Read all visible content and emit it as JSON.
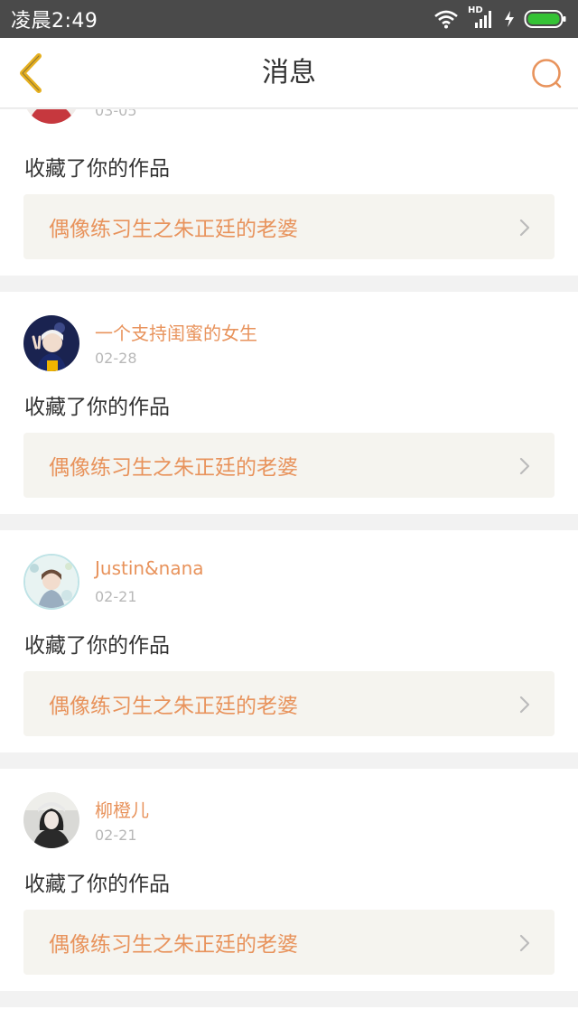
{
  "status_bar": {
    "time": "凌晨2:49",
    "network_label": "HD"
  },
  "header": {
    "title": "消息",
    "back_icon": "chevron-left-icon",
    "search_icon": "search-icon"
  },
  "colors": {
    "accent": "#e8935c",
    "back_icon": "#e6b020",
    "battery": "#35c235"
  },
  "messages": [
    {
      "user": "",
      "date": "03-05",
      "action": "收藏了你的作品",
      "work_title": "偶像练习生之朱正廷的老婆"
    },
    {
      "user": "一个支持闺蜜的女生",
      "date": "02-28",
      "action": "收藏了你的作品",
      "work_title": "偶像练习生之朱正廷的老婆"
    },
    {
      "user": "Justin&nana",
      "date": "02-21",
      "action": "收藏了你的作品",
      "work_title": "偶像练习生之朱正廷的老婆"
    },
    {
      "user": "柳橙儿",
      "date": "02-21",
      "action": "收藏了你的作品",
      "work_title": "偶像练习生之朱正廷的老婆"
    }
  ]
}
